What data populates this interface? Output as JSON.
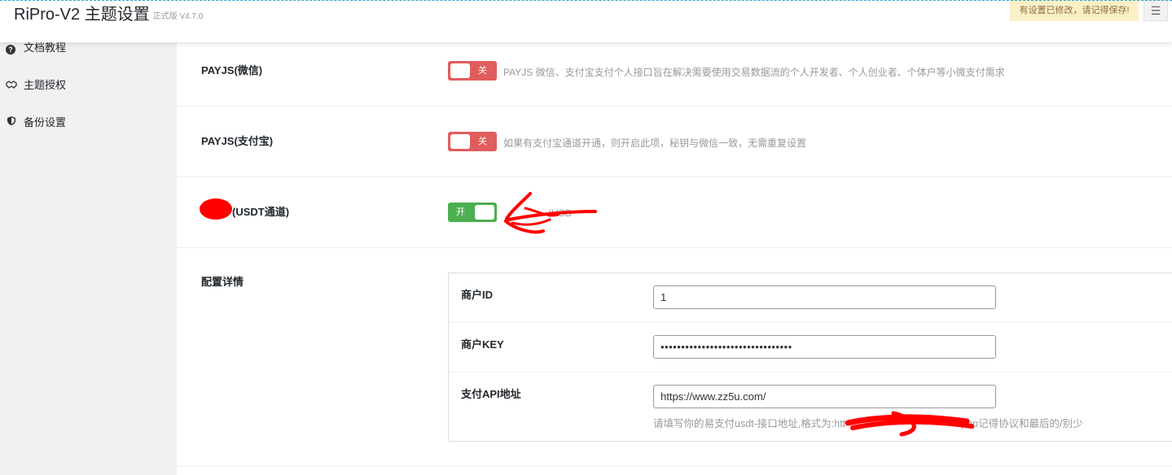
{
  "header": {
    "title": "RiPro-V2 主题设置",
    "version": "正式版 V4.7.0",
    "notice": "有设置已修改，请记得保存!",
    "toggle_icon": "menu-collapse-icon"
  },
  "sidebar": {
    "items": [
      {
        "label": "文档教程",
        "icon": "question-circle-icon"
      },
      {
        "label": "主题授权",
        "icon": "handshake-icon"
      },
      {
        "label": "备份设置",
        "icon": "shield-icon"
      }
    ]
  },
  "rows": [
    {
      "label": "PAYJS(微信)",
      "switch": "关",
      "state": "off",
      "description": "PAYJS 微信、支付宝支付个人接口旨在解决需要使用交易数据流的个人开发者、个人创业者、个体户等小微支付需求"
    },
    {
      "label": "PAYJS(支付宝)",
      "switch": "关",
      "state": "off",
      "description": "如果有支付宝通道开通，则开启此项，秘钥与微信一致，无需重复设置"
    },
    {
      "label": "(USDT通道)",
      "switch": "开",
      "state": "on",
      "description": "(USD"
    }
  ],
  "config": {
    "label": "配置详情",
    "fields": [
      {
        "label": "商户ID",
        "value": "1"
      },
      {
        "label": "商户KEY",
        "value": "••••••••••••••••••••••••••••••••"
      },
      {
        "label": "支付API地址",
        "value": "https://www.zz5u.com/",
        "help_prefix": "请填写你的易支付usdt-接口地址,格式为:htt",
        "help_suffix": "php记得协议和最后的/别少"
      }
    ]
  },
  "colors": {
    "switch_off": "#e05d5d",
    "switch_on": "#4caf50",
    "notice_bg": "#fcf0c8",
    "sidebar_bg": "#f1f1f1",
    "redaction": "#ff0000"
  }
}
